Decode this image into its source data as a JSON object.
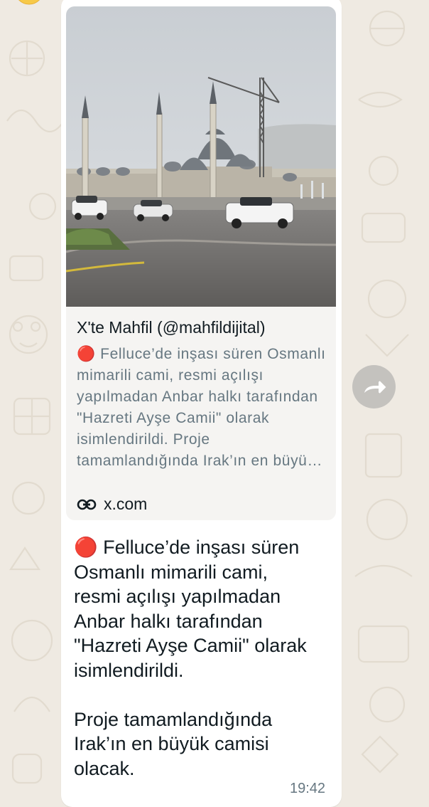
{
  "colors": {
    "wallpaper": "#efeae2",
    "bubble": "#ffffff",
    "preview_bg": "#f5f4f2",
    "text_primary": "#111b21",
    "text_secondary": "#667781",
    "red_circle": "#e0203a"
  },
  "link_preview": {
    "title": "X'te Mahfil (@mahfildijital)",
    "description": "🔴 Felluce’de inşası süren Osmanlı mimarili cami, resmi açılışı yapılmadan Anbar halkı tarafından \"Hazreti Ayşe Camii\" olarak isimlendirildi. Proje tamamlandığında Irak’ın en büyük camisi olacak.",
    "link_icon": "link-icon",
    "domain": "x.com"
  },
  "message": {
    "text": "🔴 Felluce’de inşası süren\nOsmanlı mimarili cami,\nresmi açılışı yapılmadan\nAnbar halkı tarafından\n\"Hazreti Ayşe Camii\" olarak\nisimlendirildi.\n\nProje tamamlandığında\nIrak’ın en büyük camisi\nolacak.",
    "time": "19:42"
  },
  "forward_button": {
    "icon": "forward-arrow-icon"
  }
}
